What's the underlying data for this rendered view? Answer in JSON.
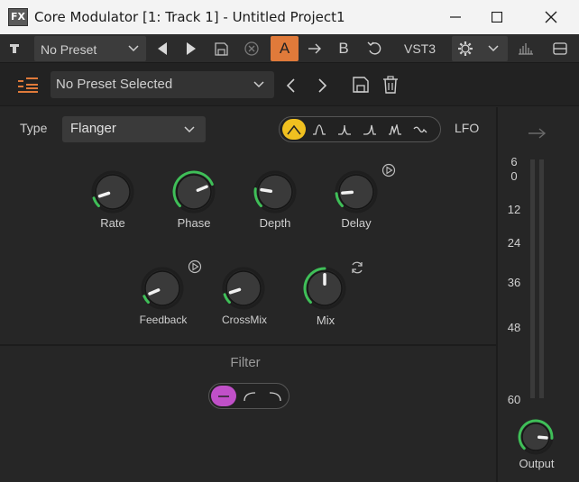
{
  "window": {
    "app_icon_text": "FX",
    "title": "Core Modulator [1: Track 1] - Untitled Project1"
  },
  "fx_toolbar": {
    "preset": "No Preset",
    "a_label": "A",
    "b_label": "B",
    "plugin_format": "VST3",
    "active_slot": "A",
    "accent_color": "#e07a3a"
  },
  "plugin_header": {
    "preset": "No Preset Selected",
    "logo_color": "#e07a3a"
  },
  "modulation": {
    "type_label": "Type",
    "type_value": "Flanger",
    "lfo_label": "LFO",
    "lfo_shapes": [
      "triangle",
      "bell",
      "peak",
      "ramp",
      "double-peak",
      "random"
    ],
    "lfo_active_index": 0,
    "lfo_active_color": "#f0c020",
    "knob_ring_color": "#3fbf58",
    "knobs": {
      "rate": {
        "label": "Rate",
        "value": 0.1
      },
      "phase": {
        "label": "Phase",
        "value": 0.75
      },
      "depth": {
        "label": "Depth",
        "value": 0.2
      },
      "delay": {
        "label": "Delay",
        "value": 0.15
      },
      "feedback": {
        "label": "Feedback",
        "value": 0.08
      },
      "crossmix": {
        "label": "CrossMix",
        "value": 0.1
      },
      "mix": {
        "label": "Mix",
        "value": 0.5
      }
    }
  },
  "filter": {
    "label": "Filter",
    "shapes": [
      "off",
      "low-shelf",
      "high-shelf"
    ],
    "active_index": 0,
    "active_color": "#c050c8"
  },
  "meter": {
    "ticks": [
      "6",
      "0",
      "12",
      "24",
      "36",
      "48",
      "60"
    ],
    "output_label": "Output",
    "output_value": 0.85
  }
}
